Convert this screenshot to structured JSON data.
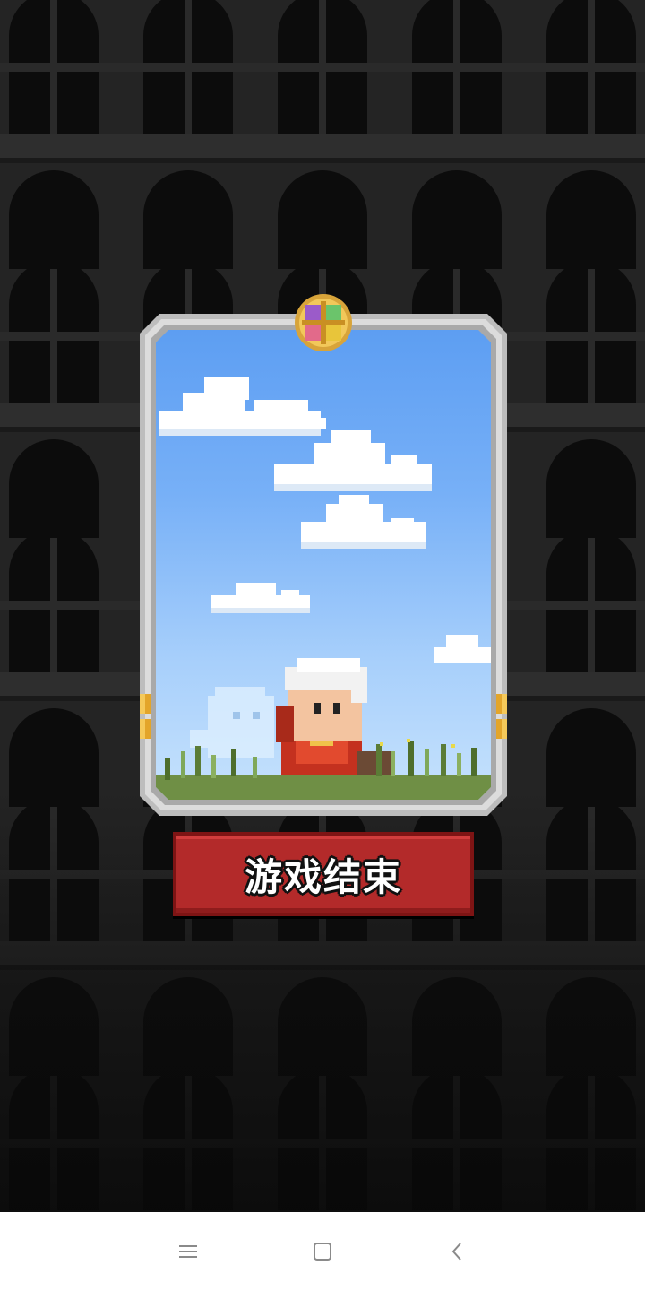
{
  "game_over_button": {
    "label": "游戏结束"
  },
  "nav": {
    "menu_icon": "menu-icon",
    "home_icon": "home-square-icon",
    "back_icon": "back-chevron-icon"
  },
  "colors": {
    "button_red": "#b32a2a",
    "sky_blue": "#6aa6f5",
    "frame_silver": "#c9c9c9",
    "tower_dark": "#242424"
  }
}
